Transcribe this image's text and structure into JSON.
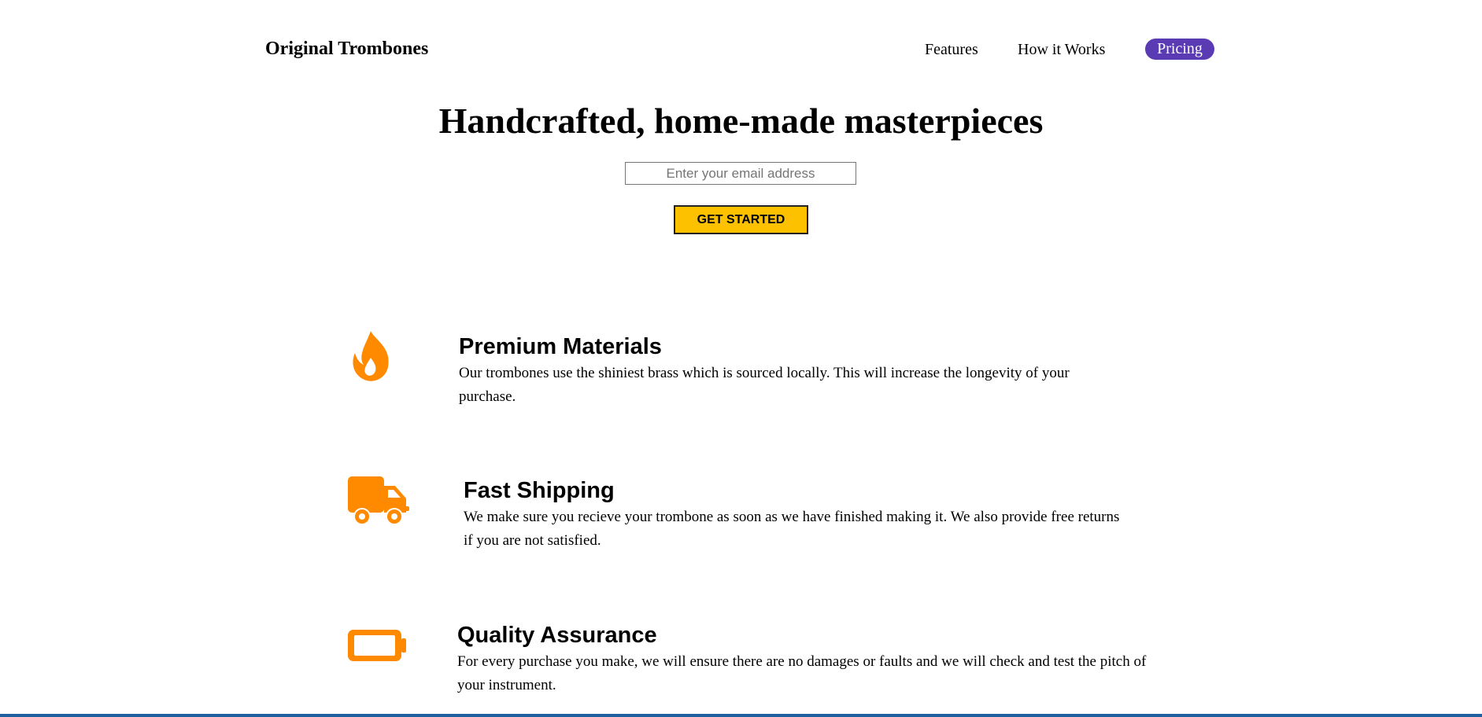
{
  "header": {
    "brand": "Original Trombones",
    "nav": [
      {
        "label": "Features"
      },
      {
        "label": "How it Works"
      },
      {
        "label": "Pricing",
        "active": true
      }
    ],
    "active_color": "#5a3bb3"
  },
  "hero": {
    "title": "Handcrafted, home-made masterpieces",
    "email_placeholder": "Enter your email address",
    "cta_label": "GET STARTED",
    "cta_color": "#fdc100"
  },
  "features": [
    {
      "icon": "fire-icon",
      "title": "Premium Materials",
      "description": "Our trombones use the shiniest brass which is sourced locally. This will increase the longevity of your purchase."
    },
    {
      "icon": "truck-icon",
      "title": "Fast Shipping",
      "description": "We make sure you recieve your trombone as soon as we have finished making it. We also provide free returns if you are not satisfied."
    },
    {
      "icon": "battery-icon",
      "title": "Quality Assurance",
      "description": "For every purchase you make, we will ensure there are no damages or faults and we will check and test the pitch of your instrument."
    }
  ],
  "icon_color": "#ff8a00"
}
